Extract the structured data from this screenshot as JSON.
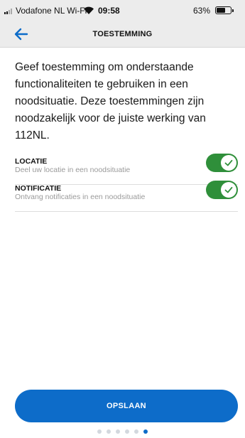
{
  "status_bar": {
    "carrier": "Vodafone NL Wi-Fi",
    "time": "09:58",
    "battery_percent": "63%",
    "battery_level": 0.63,
    "signal_icon": "signal-bars-icon",
    "wifi_icon": "wifi-icon",
    "battery_icon": "battery-icon"
  },
  "header": {
    "title": "TOESTEMMING",
    "back_icon": "back-arrow-icon"
  },
  "intro_text": "Geef toestemming om onderstaande functionaliteiten te gebruiken in een noodsituatie. Deze toestemmingen zijn noodzakelijk voor de juiste werking van 112NL.",
  "permissions": [
    {
      "title": "LOCATIE",
      "description": "Deel uw locatie in een noodsituatie",
      "enabled": true
    },
    {
      "title": "NOTIFICATIE",
      "description": "Ontvang notificaties in een noodsituatie",
      "enabled": true
    }
  ],
  "save_button": {
    "label": "OPSLAAN"
  },
  "pager": {
    "total_pages": 6,
    "current_page": 6
  },
  "colors": {
    "accent": "#0d6cc9",
    "toggle_on": "#2f8f3a",
    "header_bg": "#ececec",
    "muted_text": "#9a9a9a"
  }
}
